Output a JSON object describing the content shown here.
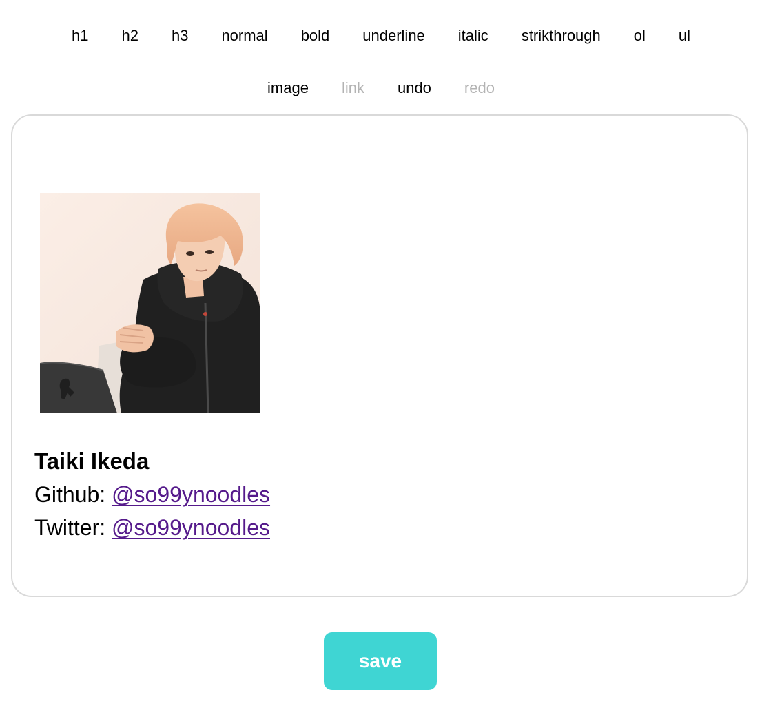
{
  "toolbar": {
    "row1": [
      {
        "label": "h1",
        "enabled": true
      },
      {
        "label": "h2",
        "enabled": true
      },
      {
        "label": "h3",
        "enabled": true
      },
      {
        "label": "normal",
        "enabled": true
      },
      {
        "label": "bold",
        "enabled": true
      },
      {
        "label": "underline",
        "enabled": true
      },
      {
        "label": "italic",
        "enabled": true
      },
      {
        "label": "strikthrough",
        "enabled": true
      },
      {
        "label": "ol",
        "enabled": true
      },
      {
        "label": "ul",
        "enabled": true
      }
    ],
    "row2": [
      {
        "label": "image",
        "enabled": true
      },
      {
        "label": "link",
        "enabled": false
      },
      {
        "label": "undo",
        "enabled": true
      },
      {
        "label": "redo",
        "enabled": false
      }
    ]
  },
  "editor": {
    "name": "Taiki Ikeda",
    "github_label": "Github: ",
    "github_handle": "@so99ynoodles",
    "twitter_label": "Twitter: ",
    "twitter_handle": "@so99ynoodles"
  },
  "save_label": "save",
  "colors": {
    "accent": "#3fd5d3",
    "link": "#551a8b",
    "disabled": "#b3b3b3",
    "border": "#d9d9d9"
  }
}
